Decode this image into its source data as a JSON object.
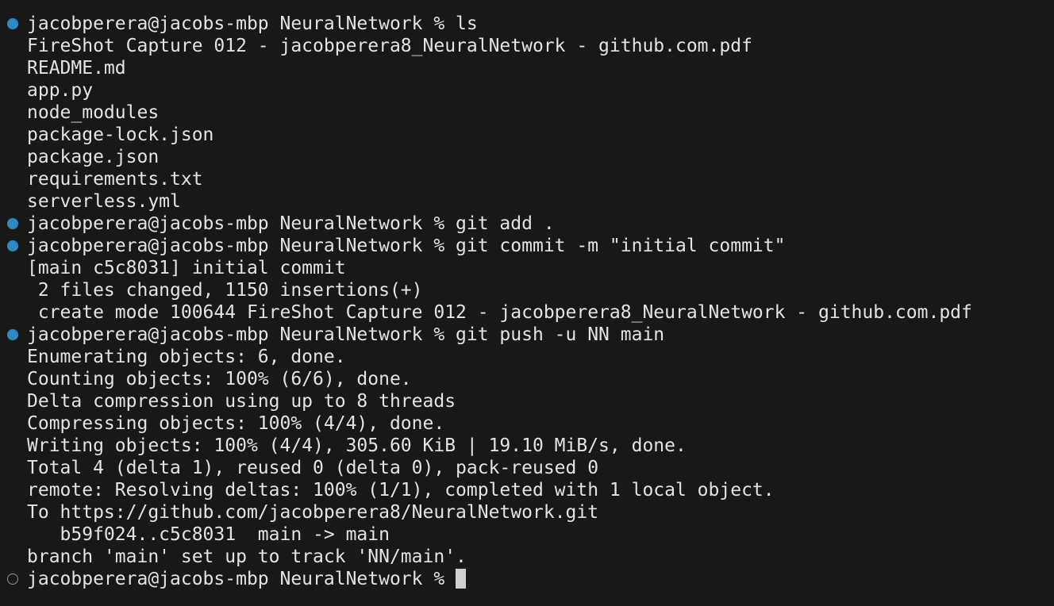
{
  "terminal": {
    "prompt": "jacobperera@jacobs-mbp NeuralNetwork % ",
    "lines": [
      {
        "kind": "command",
        "decoration": "success",
        "text": "jacobperera@jacobs-mbp NeuralNetwork % ls"
      },
      {
        "kind": "output",
        "text": "FireShot Capture 012 - jacobperera8_NeuralNetwork - github.com.pdf"
      },
      {
        "kind": "output",
        "text": "README.md"
      },
      {
        "kind": "output",
        "text": "app.py"
      },
      {
        "kind": "output",
        "text": "node_modules"
      },
      {
        "kind": "output",
        "text": "package-lock.json"
      },
      {
        "kind": "output",
        "text": "package.json"
      },
      {
        "kind": "output",
        "text": "requirements.txt"
      },
      {
        "kind": "output",
        "text": "serverless.yml"
      },
      {
        "kind": "command",
        "decoration": "success",
        "text": "jacobperera@jacobs-mbp NeuralNetwork % git add ."
      },
      {
        "kind": "command",
        "decoration": "success",
        "text": "jacobperera@jacobs-mbp NeuralNetwork % git commit -m \"initial commit\""
      },
      {
        "kind": "output",
        "text": "[main c5c8031] initial commit"
      },
      {
        "kind": "output",
        "text": " 2 files changed, 1150 insertions(+)"
      },
      {
        "kind": "output",
        "text": " create mode 100644 FireShot Capture 012 - jacobperera8_NeuralNetwork - github.com.pdf"
      },
      {
        "kind": "command",
        "decoration": "success",
        "text": "jacobperera@jacobs-mbp NeuralNetwork % git push -u NN main"
      },
      {
        "kind": "output",
        "text": "Enumerating objects: 6, done."
      },
      {
        "kind": "output",
        "text": "Counting objects: 100% (6/6), done."
      },
      {
        "kind": "output",
        "text": "Delta compression using up to 8 threads"
      },
      {
        "kind": "output",
        "text": "Compressing objects: 100% (4/4), done."
      },
      {
        "kind": "output",
        "text": "Writing objects: 100% (4/4), 305.60 KiB | 19.10 MiB/s, done."
      },
      {
        "kind": "output",
        "text": "Total 4 (delta 1), reused 0 (delta 0), pack-reused 0"
      },
      {
        "kind": "output",
        "text": "remote: Resolving deltas: 100% (1/1), completed with 1 local object."
      },
      {
        "kind": "output",
        "text": "To https://github.com/jacobperera8/NeuralNetwork.git"
      },
      {
        "kind": "output",
        "text": "   b59f024..c5c8031  main -> main"
      },
      {
        "kind": "output",
        "text": "branch 'main' set up to track 'NN/main'."
      }
    ],
    "colors": {
      "background": "#181818",
      "text": "#e3e3e3",
      "success_decoration": "#2f87c3",
      "pending_decoration": "#8f8f8f",
      "cursor": "#d0d0d0"
    }
  }
}
